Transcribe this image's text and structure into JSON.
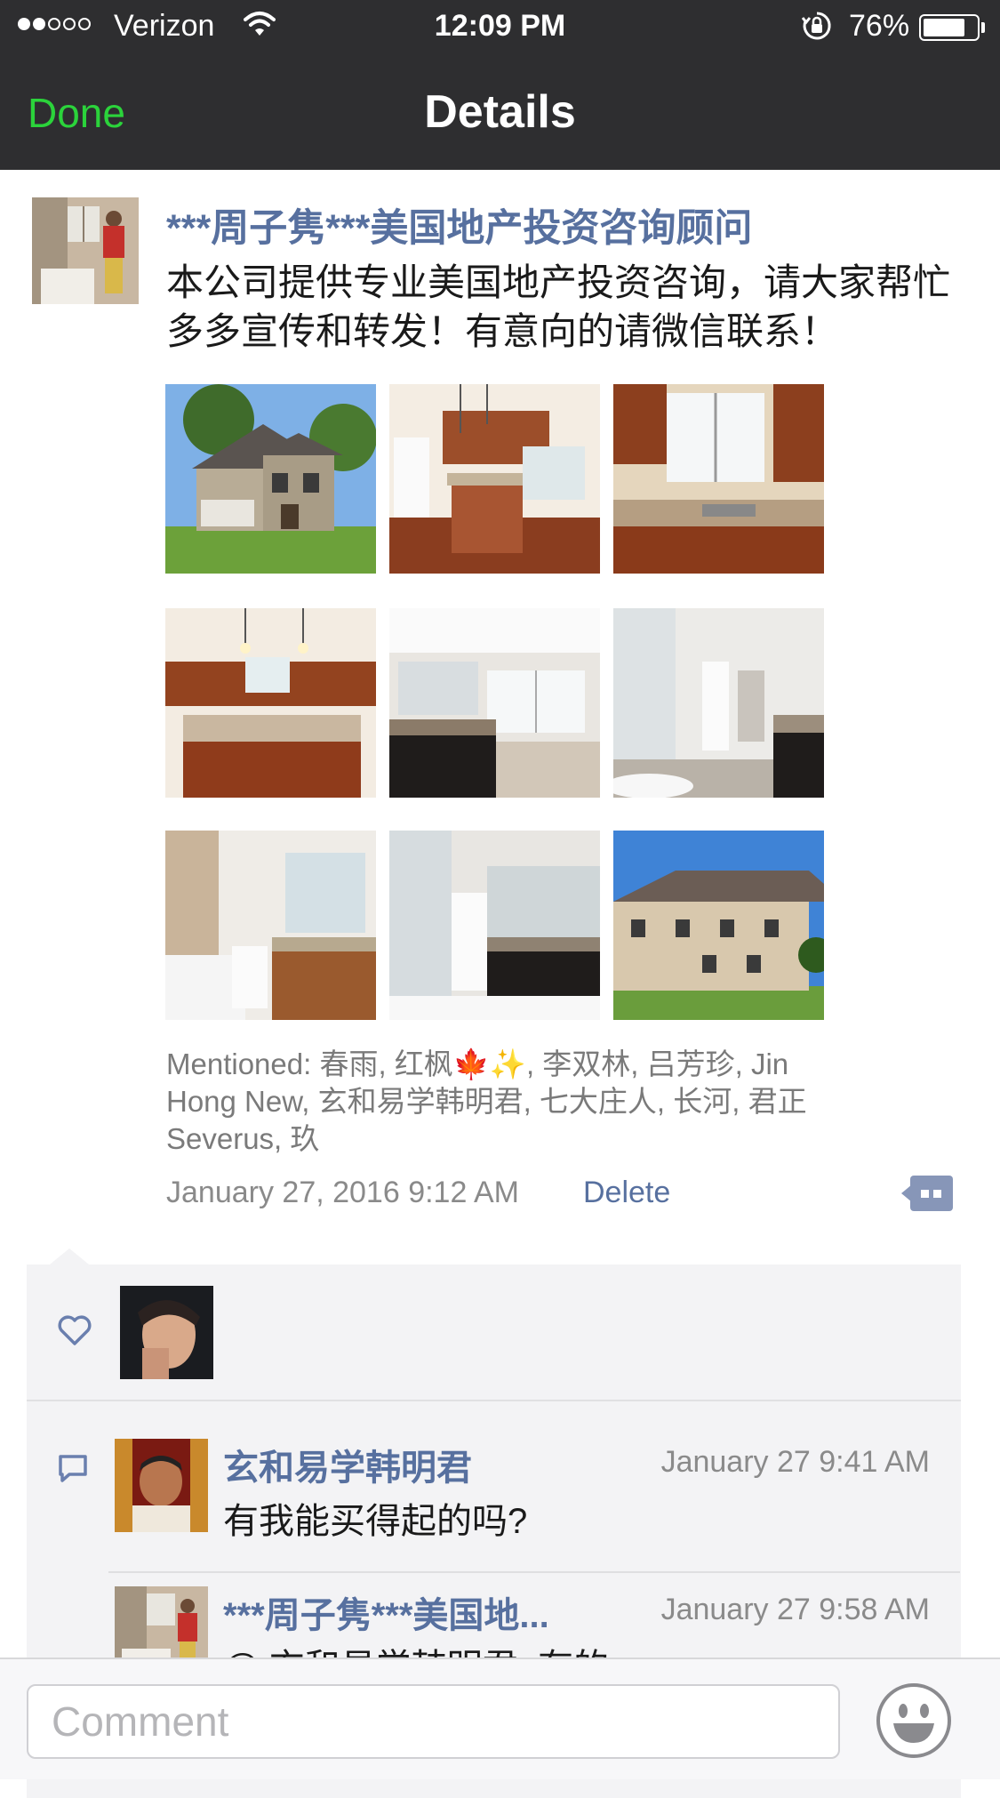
{
  "status_bar": {
    "carrier": "Verizon",
    "time": "12:09 PM",
    "battery": "76%",
    "battery_level": 0.76,
    "signal_bars_filled": 2,
    "signal_bars_total": 5
  },
  "nav": {
    "done_label": "Done",
    "title": "Details"
  },
  "post": {
    "author": "***周子隽***美国地产投资咨询顾问",
    "text": "本公司提供专业美国地产投资咨询，请大家帮忙多多宣传和转发！有意向的请微信联系！",
    "photos": [
      {
        "icon": "house-exterior-photo"
      },
      {
        "icon": "kitchen-photo"
      },
      {
        "icon": "kitchen-sink-photo"
      },
      {
        "icon": "kitchen-island-photo"
      },
      {
        "icon": "bathroom-vanity-photo"
      },
      {
        "icon": "shower-photo"
      },
      {
        "icon": "bathroom-photo"
      },
      {
        "icon": "master-bath-photo"
      },
      {
        "icon": "house-rear-photo"
      }
    ],
    "mentioned": "Mentioned: 春雨, 红枫🍁✨, 李双林, 吕芳珍, Jin Hong New, 玄和易学韩明君, 七大庄人, 长河, 君正Severus, 玖",
    "timestamp": "January 27, 2016 9:12 AM",
    "delete_label": "Delete"
  },
  "comments": [
    {
      "name": "玄和易学韩明君",
      "time": "January 27 9:41 AM",
      "text": "有我能买得起的吗?"
    },
    {
      "name": "***周子隽***美国地...",
      "time": "January 27 9:58 AM",
      "text": "@ 玄和易学韩明君: 有的"
    }
  ],
  "input": {
    "placeholder": "Comment"
  },
  "colors": {
    "nav_bg": "#2e2e30",
    "done_green": "#2bd33b",
    "link_blue": "#57709f",
    "panel_bg": "#f3f3f5"
  }
}
